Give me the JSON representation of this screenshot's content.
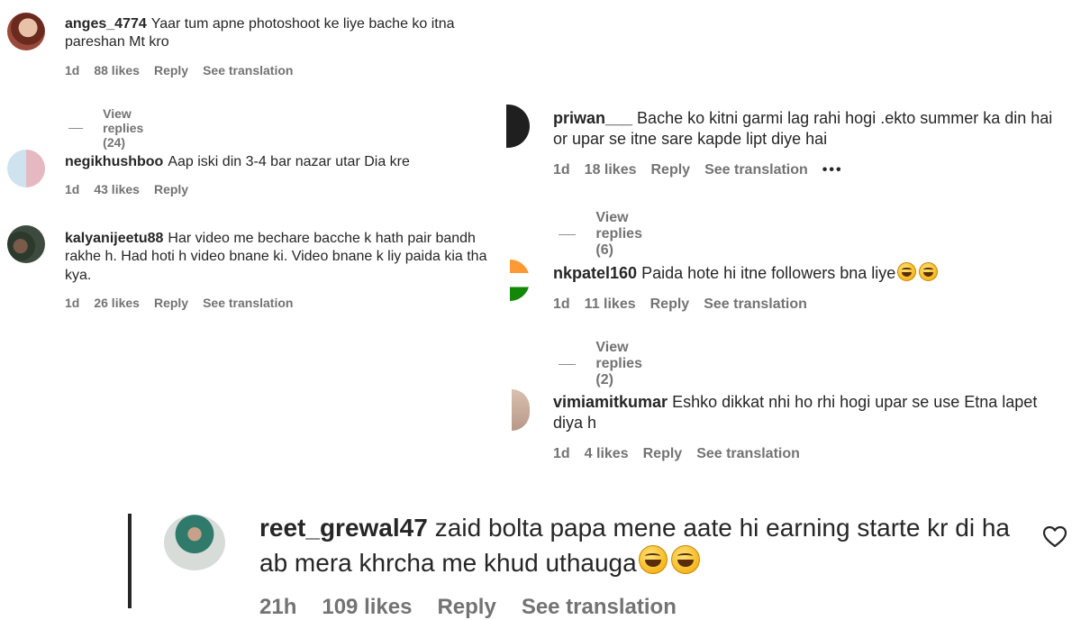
{
  "comments": [
    {
      "username": "anges_4774",
      "text": "Yaar tum apne photoshoot ke liye bache ko itna pareshan Mt kro",
      "time": "1d",
      "likes": "88 likes",
      "reply_label": "Reply",
      "translate_label": "See translation",
      "view_replies": "View replies (24)"
    },
    {
      "username": "negikhushboo",
      "text": "Aap iski din 3-4 bar nazar utar Dia kre",
      "time": "1d",
      "likes": "43 likes",
      "reply_label": "Reply"
    },
    {
      "username": "kalyanijeetu88",
      "text": "Har video me bechare bacche k hath pair bandh rakhe h. Had hoti h video bnane ki. Video bnane k liy paida kia tha kya.",
      "time": "1d",
      "likes": "26 likes",
      "reply_label": "Reply",
      "translate_label": "See translation"
    },
    {
      "username": "priwan___",
      "text": "Bache ko kitni garmi lag rahi hogi .ekto summer ka din hai or upar se itne sare kapde lipt diye hai",
      "time": "1d",
      "likes": "18 likes",
      "reply_label": "Reply",
      "translate_label": "See translation",
      "more_label": "•••",
      "view_replies": "View replies (6)"
    },
    {
      "username": "nkpatel160",
      "text": "Paida hote hi itne followers bna liye",
      "time": "1d",
      "likes": "11 likes",
      "reply_label": "Reply",
      "translate_label": "See translation",
      "view_replies": "View replies (2)"
    },
    {
      "username": "vimiamitkumar",
      "text": "Eshko dikkat nhi ho rhi hogi upar se use Etna lapet diya h",
      "time": "1d",
      "likes": "4 likes",
      "reply_label": "Reply",
      "translate_label": "See translation"
    },
    {
      "username": "reet_grewal47",
      "text": "zaid bolta papa mene aate hi earning starte kr di ha ab mera khrcha me khud uthauga",
      "time": "21h",
      "likes": "109 likes",
      "reply_label": "Reply",
      "translate_label": "See translation",
      "icon": "heart-icon"
    }
  ],
  "colors": {
    "text": "#262626",
    "meta": "#737373",
    "background": "#ffffff"
  }
}
